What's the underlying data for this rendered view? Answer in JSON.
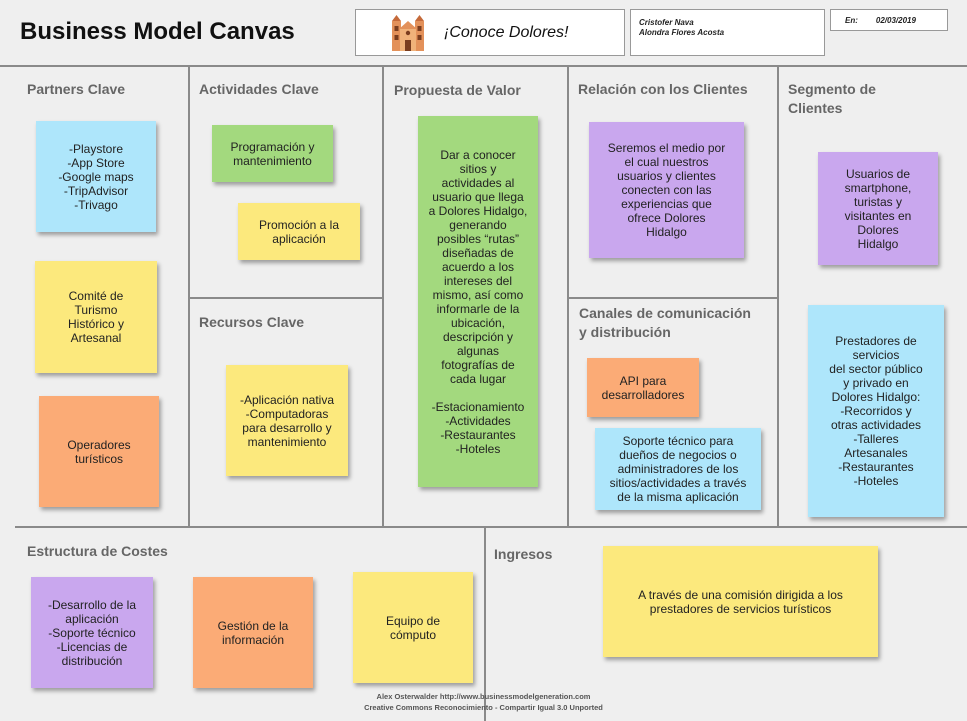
{
  "header": {
    "title": "Business Model Canvas",
    "project_name": "¡Conoce Dolores!",
    "authors": [
      "Cristofer Nava",
      "Alondra Flores Acosta"
    ],
    "date_label": "En:",
    "date_value": "02/03/2019"
  },
  "sections": {
    "partners": "Partners Clave",
    "activities": "Actividades Clave",
    "value": "Propuesta de Valor",
    "relations": "Relación con los Clientes",
    "segments": "Segmento de\nClientes",
    "resources": "Recursos Clave",
    "channels": "Canales de comunicación\ny distribución",
    "costs": "Estructura de Costes",
    "revenue": "Ingresos"
  },
  "notes": {
    "partners_1": "-Playstore\n-App Store\n-Google maps\n-TripAdvisor\n-Trivago",
    "partners_2": "Comité de\nTurismo\nHistórico y\nArtesanal",
    "partners_3": "Operadores\nturísticos",
    "activities_1": "Programación y\nmantenimiento",
    "activities_2": "Promoción a la\naplicación",
    "resources_1": "-Aplicación nativa\n-Computadoras\npara desarrollo y\nmantenimiento",
    "value_1": "Dar a conocer\nsitios y\nactividades al\nusuario que llega\na Dolores Hidalgo,\ngenerando\nposibles “rutas”\ndiseñadas de\nacuerdo a los\nintereses del\nmismo, así como\ninformarle de la\nubicación,\ndescripción y\nalgunas\nfotografías de\ncada lugar\n\n-Estacionamiento\n-Actividades\n-Restaurantes\n-Hoteles",
    "relations_1": "Seremos el medio por\nel cual nuestros\nusuarios y clientes\nconecten con las\nexperiencias que\nofrece Dolores\nHidalgo",
    "channels_1": "API para\ndesarrolladores",
    "channels_2": "Soporte técnico para\ndueños de negocios o\nadministradores de los\nsitios/actividades  a través\nde la misma aplicación",
    "segments_1": "Usuarios de\nsmartphone,\nturistas y\nvisitantes en\nDolores\nHidalgo",
    "segments_2": "Prestadores de\nservicios\ndel sector público\ny privado en\nDolores Hidalgo:\n-Recorridos y\notras actividades\n-Talleres\nArtesanales\n-Restaurantes\n-Hoteles",
    "costs_1": "-Desarrollo de la\naplicación\n-Soporte técnico\n-Licencias de\ndistribución",
    "costs_2": "Gestión de la\ninformación",
    "costs_3": "Equipo de\ncómputo",
    "revenue_1": "A través de una comisión dirigida a los\nprestadores de servicios turísticos"
  },
  "footer": {
    "line1": "Alex Osterwalder http://www.businessmodelgeneration.com",
    "line2": "Creative Commons Reconocimiento - Compartir Igual 3.0 Unported"
  },
  "colors": {
    "blue": "#aee6fb",
    "yellow": "#fce97d",
    "orange": "#fbab76",
    "green": "#a3d97e",
    "purple": "#c9a7ee"
  },
  "icons": {
    "project": "church-icon"
  }
}
